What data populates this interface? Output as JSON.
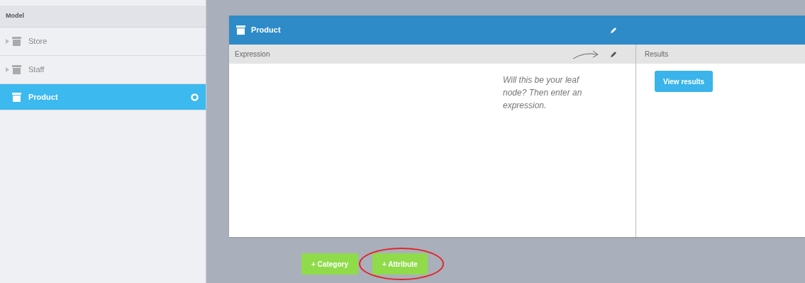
{
  "sidebar": {
    "header": "Model",
    "items": [
      {
        "label": "Store",
        "selected": false,
        "expandable": true
      },
      {
        "label": "Staff",
        "selected": false,
        "expandable": true
      },
      {
        "label": "Product",
        "selected": true,
        "expandable": false
      }
    ]
  },
  "card": {
    "title": "Product",
    "expression": {
      "header": "Expression",
      "hint": "Will this be your leaf node? Then enter an expression."
    },
    "results": {
      "header": "Results",
      "button": "View results"
    }
  },
  "actions": [
    {
      "label": "+ Category",
      "circled": false
    },
    {
      "label": "+ Attribute",
      "circled": true
    }
  ]
}
